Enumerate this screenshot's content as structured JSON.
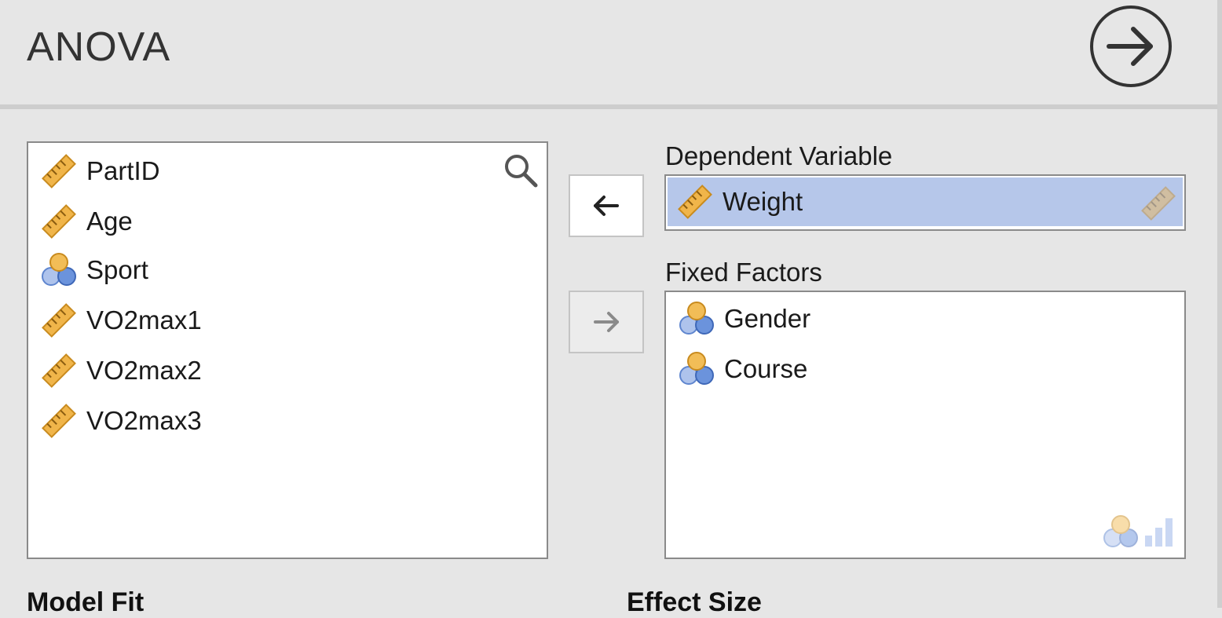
{
  "app": {
    "title": "ANOVA"
  },
  "variables": [
    {
      "name": "PartID",
      "type": "continuous"
    },
    {
      "name": "Age",
      "type": "continuous"
    },
    {
      "name": "Sport",
      "type": "nominal"
    },
    {
      "name": "VO2max1",
      "type": "continuous"
    },
    {
      "name": "VO2max2",
      "type": "continuous"
    },
    {
      "name": "VO2max3",
      "type": "continuous"
    }
  ],
  "dependent": {
    "label": "Dependent Variable",
    "value": "Weight",
    "type": "continuous"
  },
  "fixed": {
    "label": "Fixed Factors",
    "items": [
      "Gender",
      "Course"
    ]
  },
  "sections": {
    "model_fit": "Model Fit",
    "effect_size": "Effect Size"
  },
  "icons": {
    "run": "arrow-right-circle-icon",
    "search": "search-icon",
    "move_left": "arrow-left-icon",
    "move_right": "arrow-right-icon",
    "continuous": "ruler-icon",
    "nominal": "nominal-circles-icon"
  },
  "colors": {
    "selection": "#b6c7ea",
    "ruler": "#f0b54a",
    "nominal_top": "#f2bd57",
    "nominal_bottom": "#6b93dc"
  }
}
